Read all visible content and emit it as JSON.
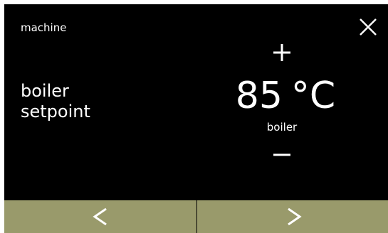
{
  "header": {
    "section_title": "machine"
  },
  "parameter": {
    "label_line1": "boiler",
    "label_line2": "setpoint",
    "value": "85",
    "unit": "°C",
    "sublabel": "boiler"
  },
  "icons": {
    "close": "close-icon",
    "increase": "plus-icon",
    "decrease": "minus-icon",
    "previous": "chevron-left-icon",
    "next": "chevron-right-icon"
  },
  "colors": {
    "background": "#000000",
    "text": "#ffffff",
    "footer": "#999a6b",
    "divider": "#000000"
  }
}
